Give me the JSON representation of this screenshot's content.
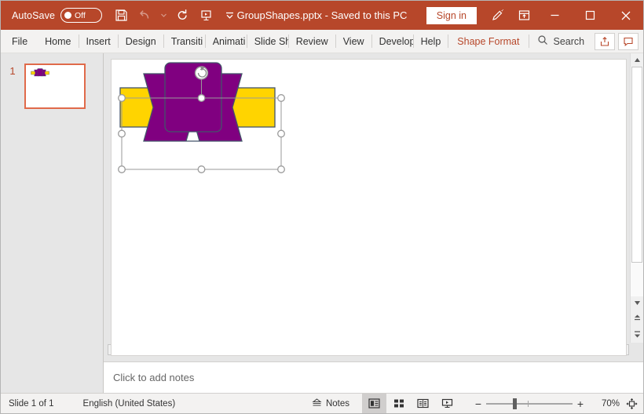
{
  "titlebar": {
    "autosave_label": "AutoSave",
    "autosave_state": "Off",
    "file_name": "GroupShapes.pptx",
    "save_state": "-  Saved to this PC",
    "signin_label": "Sign in",
    "quick_access": [
      {
        "name": "save-icon",
        "label": "Save"
      },
      {
        "name": "undo-icon",
        "label": "Undo"
      },
      {
        "name": "redo-icon",
        "label": "Redo"
      },
      {
        "name": "start-presentation-icon",
        "label": "Start from Beginning"
      },
      {
        "name": "customize-quick-access-toolbar-icon",
        "label": "Customize Quick Access Toolbar"
      }
    ],
    "window_buttons": [
      {
        "name": "pen-icon",
        "label": "Draw"
      },
      {
        "name": "ribbon-display-options-icon",
        "label": "Ribbon Display Options"
      },
      {
        "name": "minimize-button",
        "label": "Minimize"
      },
      {
        "name": "maximize-button",
        "label": "Maximize"
      },
      {
        "name": "close-button",
        "label": "Close"
      }
    ],
    "accent_color": "#b7472a"
  },
  "ribbon": {
    "tabs": [
      {
        "label": "File",
        "active": false
      },
      {
        "label": "Home",
        "active": false
      },
      {
        "label": "Insert",
        "active": false
      },
      {
        "label": "Design",
        "active": false
      },
      {
        "label": "Transiti",
        "active": false
      },
      {
        "label": "Animati",
        "active": false
      },
      {
        "label": "Slide Sh",
        "active": false
      },
      {
        "label": "Review",
        "active": false
      },
      {
        "label": "View",
        "active": false
      },
      {
        "label": "Develop",
        "active": false
      },
      {
        "label": "Help",
        "active": false
      },
      {
        "label": "Shape Format",
        "active": true
      }
    ],
    "search_label": "Search",
    "share_label": "Share",
    "comments_label": "Comments"
  },
  "thumbnails": {
    "slides": [
      {
        "number": "1",
        "selected": true
      }
    ]
  },
  "slide_canvas": {
    "shapes": [
      {
        "name": "yellow-rectangle",
        "fill": "#ffd400",
        "stroke": "#44546a"
      },
      {
        "name": "purple-ribbon-banner",
        "fill": "#800080",
        "stroke": "#44546a"
      },
      {
        "name": "purple-rounded-rectangle",
        "fill": "#800080",
        "stroke": "#44546a"
      }
    ],
    "selection": {
      "rotate_handle": "rotate-handle",
      "handle_count": 8
    }
  },
  "notes": {
    "placeholder": "Click to add notes"
  },
  "statusbar": {
    "slide_indicator": "Slide 1 of 1",
    "language": "English (United States)",
    "notes_label": "Notes",
    "views": [
      {
        "name": "normal-view-button",
        "label": "Normal",
        "active": true
      },
      {
        "name": "slide-sorter-view-button",
        "label": "Slide Sorter",
        "active": false
      },
      {
        "name": "reading-view-button",
        "label": "Reading View",
        "active": false
      },
      {
        "name": "slide-show-button",
        "label": "Slide Show",
        "active": false
      }
    ],
    "zoom_out_label": "−",
    "zoom_in_label": "+",
    "zoom_level": "70%",
    "fit_label": "Fit slide to current window"
  }
}
